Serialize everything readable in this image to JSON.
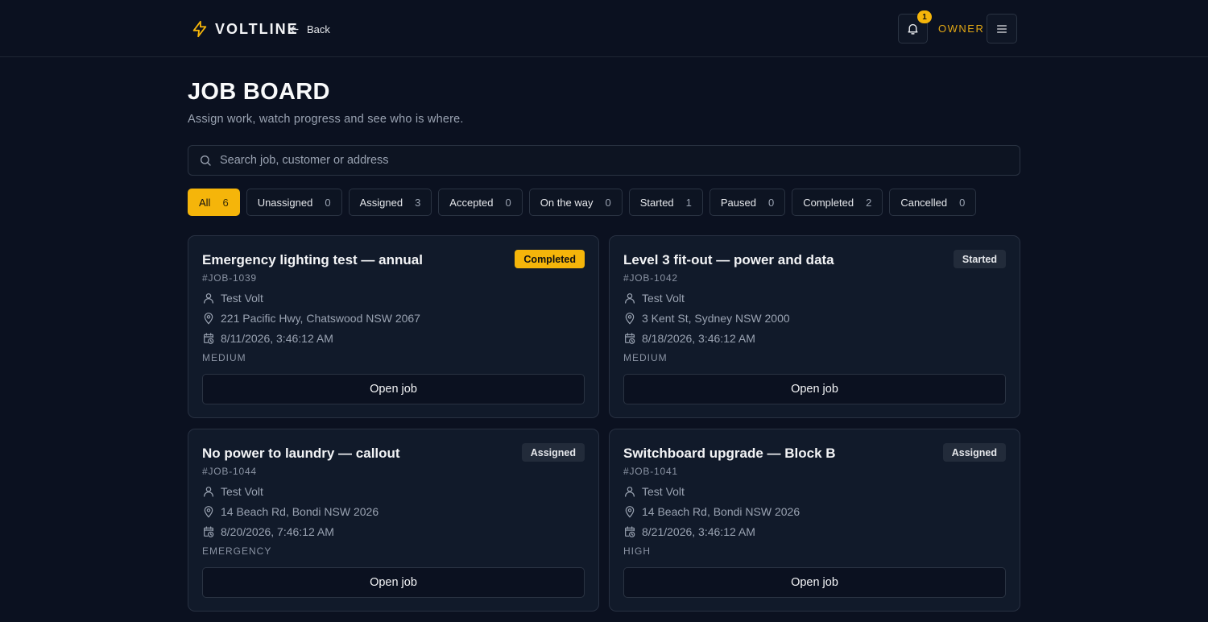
{
  "header": {
    "brand": "VOLTLINE",
    "back_label": "Back",
    "notifications_count": "1",
    "role": "OWNER"
  },
  "page": {
    "title": "JOB BOARD",
    "subtitle": "Assign work, watch progress and see who is where."
  },
  "search": {
    "placeholder": "Search job, customer or address",
    "value": ""
  },
  "filters": [
    {
      "label": "All",
      "count": "6",
      "active": true
    },
    {
      "label": "Unassigned",
      "count": "0"
    },
    {
      "label": "Assigned",
      "count": "3"
    },
    {
      "label": "Accepted",
      "count": "0"
    },
    {
      "label": "On the way",
      "count": "0"
    },
    {
      "label": "Started",
      "count": "1"
    },
    {
      "label": "Paused",
      "count": "0"
    },
    {
      "label": "Completed",
      "count": "2"
    },
    {
      "label": "Cancelled",
      "count": "0"
    }
  ],
  "jobs": [
    {
      "title": "Emergency lighting test — annual",
      "id": "#JOB-1039",
      "status": "Completed",
      "customer": "Test Volt",
      "address": "221 Pacific Hwy, Chatswood NSW 2067",
      "scheduled": "8/11/2026, 3:46:12 AM",
      "priority": "MEDIUM",
      "action": "Open job"
    },
    {
      "title": "Level 3 fit-out — power and data",
      "id": "#JOB-1042",
      "status": "Started",
      "customer": "Test Volt",
      "address": "3 Kent St, Sydney NSW 2000",
      "scheduled": "8/18/2026, 3:46:12 AM",
      "priority": "MEDIUM",
      "action": "Open job"
    },
    {
      "title": "No power to laundry — callout",
      "id": "#JOB-1044",
      "status": "Assigned",
      "customer": "Test Volt",
      "address": "14 Beach Rd, Bondi NSW 2026",
      "scheduled": "8/20/2026, 7:46:12 AM",
      "priority": "EMERGENCY",
      "action": "Open job"
    },
    {
      "title": "Switchboard upgrade — Block B",
      "id": "#JOB-1041",
      "status": "Assigned",
      "customer": "Test Volt",
      "address": "14 Beach Rd, Bondi NSW 2026",
      "scheduled": "8/21/2026, 3:46:12 AM",
      "priority": "HIGH",
      "action": "Open job"
    }
  ],
  "colors": {
    "accent": "#f5b50a",
    "background": "#0b1120",
    "card": "#111a2a",
    "border": "#2a3342",
    "muted_text": "#9aa3b2"
  }
}
